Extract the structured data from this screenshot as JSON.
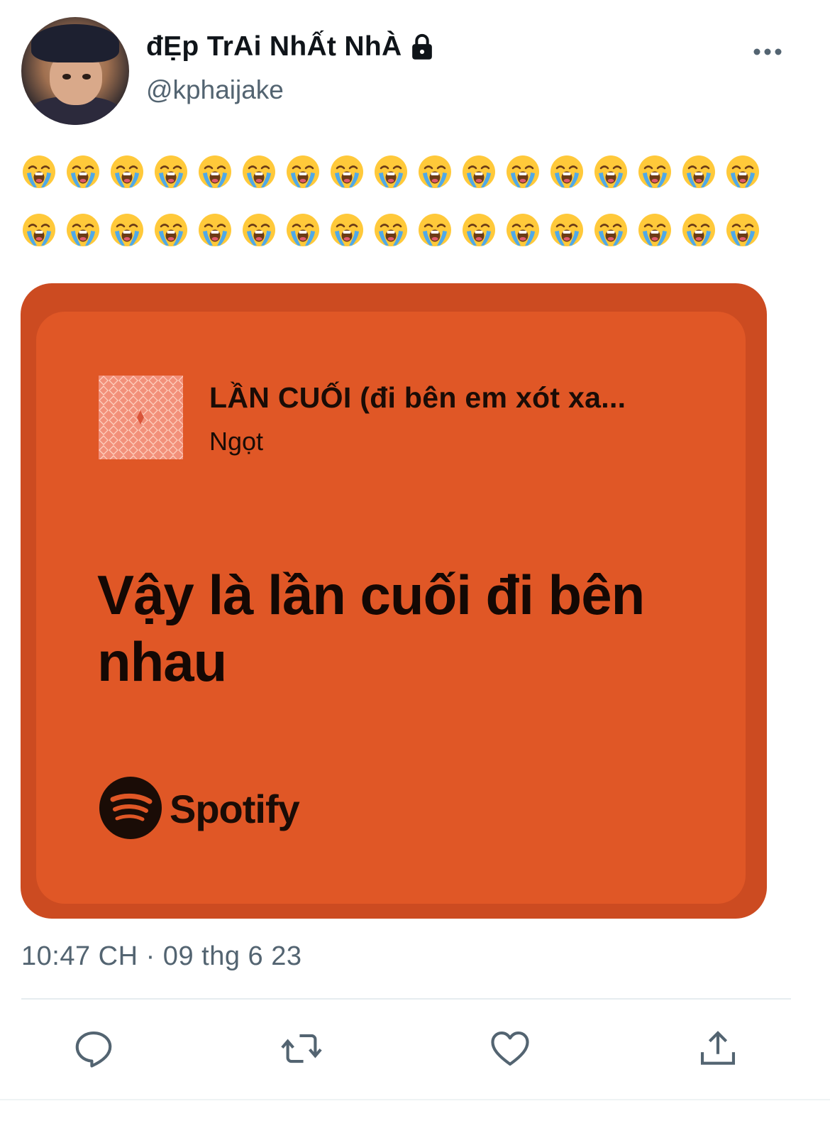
{
  "author": {
    "display_name": "đẸp TrAi NhẤt NhÀ",
    "handle": "@kphaijake",
    "protected_icon": "lock-icon",
    "avatar_icon": "profile-photo"
  },
  "tweet": {
    "emoji": "crying-face",
    "emoji_rows": [
      17,
      17
    ],
    "timestamp": "10:47 CH · 09 thg 6 23"
  },
  "spotify_card": {
    "song_title": "LẦN CUỐI (đi bên em xót xa...",
    "artist": "Ngọt",
    "lyric": "Vậy là lần cuối đi bên nhau",
    "brand": "Spotify",
    "background_color": "#e05726",
    "border_color": "#cc4b21"
  },
  "actions": [
    {
      "name": "reply",
      "icon": "speech-bubble-icon"
    },
    {
      "name": "retweet",
      "icon": "retweet-icon"
    },
    {
      "name": "like",
      "icon": "heart-icon"
    },
    {
      "name": "share",
      "icon": "share-icon"
    }
  ]
}
